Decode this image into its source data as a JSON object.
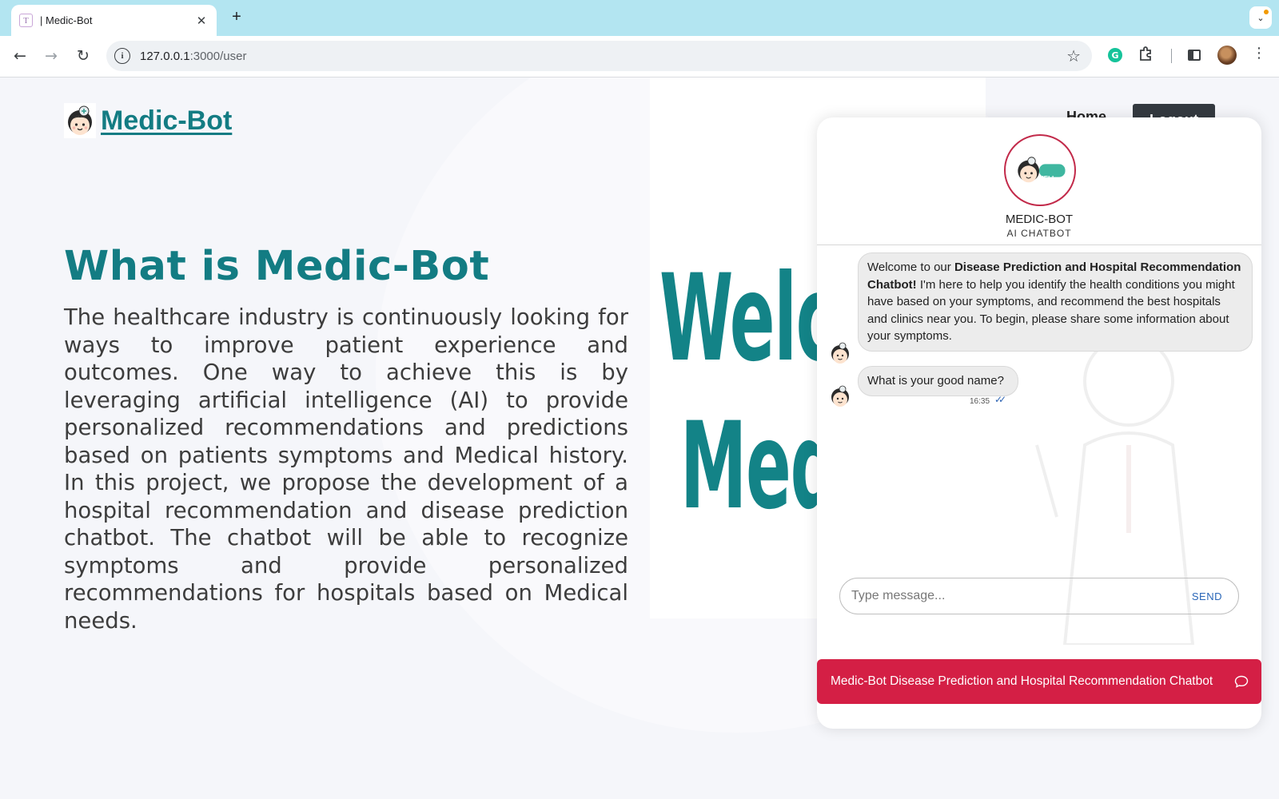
{
  "browser": {
    "tab_title": "| Medic-Bot",
    "tab_favicon": "T",
    "tab_close": "✕",
    "new_tab": "+",
    "url_host": "127.0.0.1",
    "url_path": ":3000/user",
    "extension_letter": "G"
  },
  "nav": {
    "brand": "Medic-Bot",
    "home": "Home",
    "logout": "Logout"
  },
  "hero": {
    "title": "What is Medic-Bot",
    "body": "The healthcare industry is continuously looking for ways to improve patient experience and outcomes. One way to achieve this is by leveraging artificial intelligence (AI) to provide personalized recommendations and predictions based on patients symptoms and Medical history. In this project, we propose the development of a hospital recommendation and disease prediction chatbot. The chatbot will be able to recognize symptoms and provide personalized recommendations for hospitals based on Medical needs."
  },
  "welcome_art": {
    "line1": "Welcome to",
    "line2": "Medic-Bot"
  },
  "chat": {
    "avatar_badge": "HELL",
    "name": "MEDIC-BOT",
    "subtitle": "AI CHATBOT",
    "messages": [
      {
        "pre": "Welcome to our ",
        "bold": "Disease Prediction and Hospital Recommendation Chatbot!",
        "post": " I'm here to help you identify the health conditions you might have based on your symptoms, and recommend the best hospitals and clinics near you. To begin, please share some information about your symptoms."
      },
      {
        "text": "What is your good name?",
        "time": "16:35",
        "status": "✓✓"
      }
    ],
    "input_placeholder": "Type message...",
    "input_value": "",
    "send_label": "SEND",
    "launcher_label": "Medic-Bot Disease Prediction and Hospital Recommendation Chatbot"
  },
  "colors": {
    "brand_teal": "#137c83",
    "accent_red": "#d41f45",
    "logout_bg": "#343a40",
    "bubble_bg": "#ececec"
  }
}
